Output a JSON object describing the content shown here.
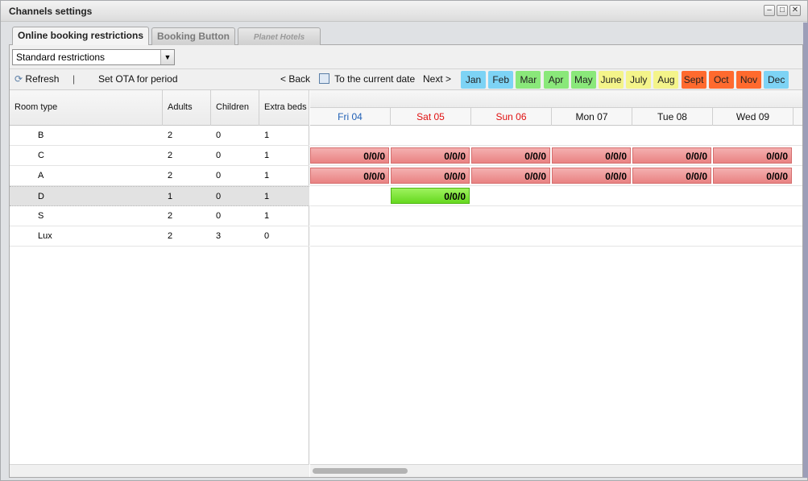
{
  "window": {
    "title": "Channels settings"
  },
  "tabs": [
    {
      "label": "Online booking restrictions",
      "active": true
    },
    {
      "label": "Booking Button",
      "active": false
    },
    {
      "label": "Planet Hotels",
      "active": false
    }
  ],
  "filter": {
    "selected": "Standard restrictions"
  },
  "toolbar": {
    "refresh": "Refresh",
    "separator": "|",
    "set_ota": "Set OTA for period",
    "back": "< Back",
    "current": "To the current date",
    "next": "Next >"
  },
  "months": [
    {
      "label": "Jan",
      "color": "#7dd3f5"
    },
    {
      "label": "Feb",
      "color": "#7dd3f5"
    },
    {
      "label": "Mar",
      "color": "#8ae87a"
    },
    {
      "label": "Apr",
      "color": "#8ae87a"
    },
    {
      "label": "May",
      "color": "#8ae87a"
    },
    {
      "label": "June",
      "color": "#f4f48a"
    },
    {
      "label": "July",
      "color": "#f4f48a"
    },
    {
      "label": "Aug",
      "color": "#f4f48a"
    },
    {
      "label": "Sept",
      "color": "#ff6a2e"
    },
    {
      "label": "Oct",
      "color": "#ff6a2e"
    },
    {
      "label": "Nov",
      "color": "#ff6a2e"
    },
    {
      "label": "Dec",
      "color": "#7dd3f5"
    }
  ],
  "columns": {
    "room_type": "Room type",
    "adults": "Adults",
    "children": "Children",
    "extra_beds": "Extra beds"
  },
  "days": [
    {
      "label": "Fri 04",
      "color": "#1f5fb5"
    },
    {
      "label": "Sat 05",
      "color": "#e01010"
    },
    {
      "label": "Sun 06",
      "color": "#e01010"
    },
    {
      "label": "Mon 07",
      "color": "#111111"
    },
    {
      "label": "Tue 08",
      "color": "#111111"
    },
    {
      "label": "Wed 09",
      "color": "#111111"
    }
  ],
  "rooms": [
    {
      "type": "B",
      "adults": "2",
      "children": "0",
      "extra_beds": "1",
      "selected": false,
      "cells": []
    },
    {
      "type": "C",
      "adults": "2",
      "children": "0",
      "extra_beds": "1",
      "selected": false,
      "cells": [
        "0/0/0",
        "0/0/0",
        "0/0/0",
        "0/0/0",
        "0/0/0",
        "0/0/0"
      ],
      "cell_style": "red"
    },
    {
      "type": "A",
      "adults": "2",
      "children": "0",
      "extra_beds": "1",
      "selected": false,
      "cells": [
        "0/0/0",
        "0/0/0",
        "0/0/0",
        "0/0/0",
        "0/0/0",
        "0/0/0"
      ],
      "cell_style": "red"
    },
    {
      "type": "D",
      "adults": "1",
      "children": "0",
      "extra_beds": "1",
      "selected": true,
      "cells": [
        "",
        "0/0/0"
      ],
      "cell_style": "green"
    },
    {
      "type": "S",
      "adults": "2",
      "children": "0",
      "extra_beds": "1",
      "selected": false,
      "cells": []
    },
    {
      "type": "Lux",
      "adults": "2",
      "children": "3",
      "extra_beds": "0",
      "selected": false,
      "cells": []
    }
  ]
}
